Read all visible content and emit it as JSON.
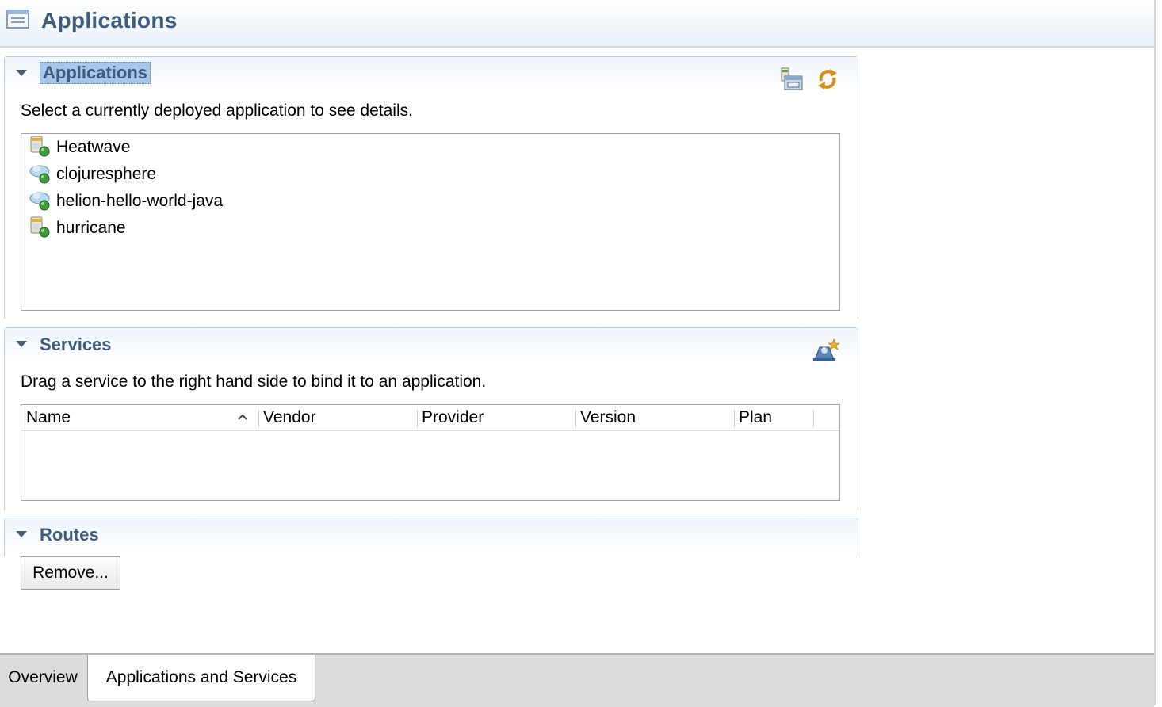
{
  "editor": {
    "title": "Applications",
    "icon": "editor-form-icon"
  },
  "applications_section": {
    "title": "Applications",
    "description": "Select a currently deployed application to see details.",
    "tools": [
      "deploy-app-icon",
      "refresh-icon"
    ],
    "items": [
      {
        "label": "Heatwave",
        "icon": "app-server-icon"
      },
      {
        "label": "clojuresphere",
        "icon": "app-cloud-icon"
      },
      {
        "label": "helion-hello-world-java",
        "icon": "app-cloud-icon"
      },
      {
        "label": "hurricane",
        "icon": "app-server-icon"
      }
    ]
  },
  "services_section": {
    "title": "Services",
    "description": "Drag a service to the right hand side to bind it to an application.",
    "tools": [
      "add-service-icon"
    ],
    "columns": [
      "Name",
      "Vendor",
      "Provider",
      "Version",
      "Plan"
    ],
    "sorted_column": "Name",
    "rows": []
  },
  "routes_section": {
    "title": "Routes",
    "remove_label": "Remove..."
  },
  "tabs": [
    {
      "label": "Overview",
      "active": false
    },
    {
      "label": "Applications and Services",
      "active": true
    }
  ]
}
